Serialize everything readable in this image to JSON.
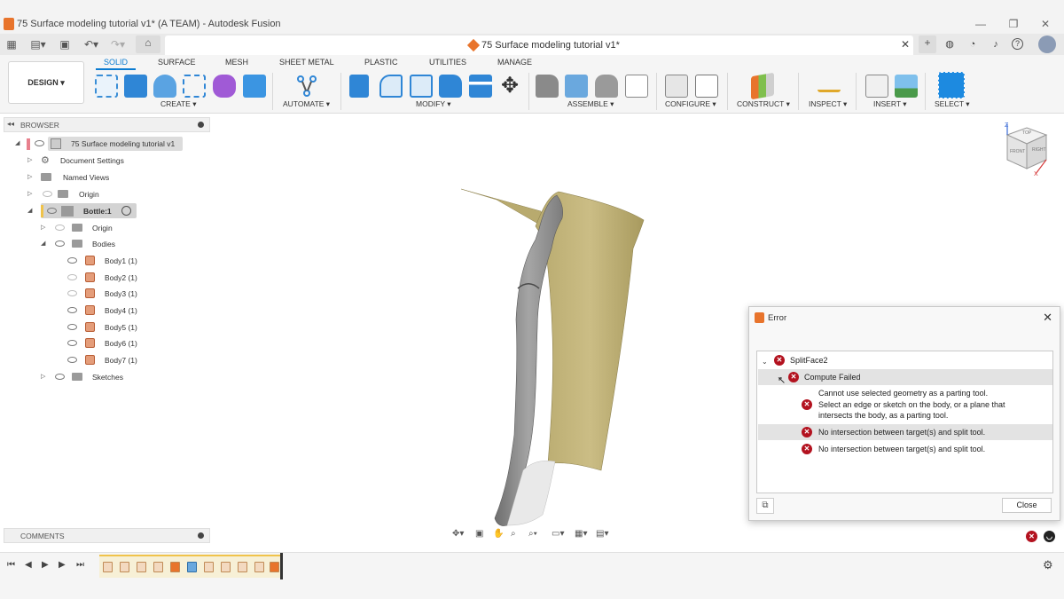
{
  "window": {
    "title": "75 Surface modeling tutorial v1* (A TEAM) - Autodesk Fusion",
    "minimize": "—",
    "maximize": "❐",
    "close": "✕"
  },
  "tabbar": {
    "document_tab": "75 Surface modeling tutorial v1*",
    "document_close": "✕",
    "new_tab": "+"
  },
  "toolbar": {
    "workspace_button": "DESIGN ▾",
    "workspace_tabs": [
      "SOLID",
      "SURFACE",
      "MESH",
      "SHEET METAL",
      "PLASTIC",
      "UTILITIES",
      "MANAGE"
    ],
    "active_tab": "SOLID",
    "groups": [
      {
        "label": "CREATE ▾"
      },
      {
        "label": "AUTOMATE ▾"
      },
      {
        "label": "MODIFY ▾"
      },
      {
        "label": "ASSEMBLE ▾"
      },
      {
        "label": "CONFIGURE ▾"
      },
      {
        "label": "CONSTRUCT ▾"
      },
      {
        "label": "INSPECT ▾"
      },
      {
        "label": "INSERT ▾"
      },
      {
        "label": "SELECT ▾"
      }
    ],
    "accent_color": "#0a7bd1"
  },
  "browser": {
    "title": "BROWSER",
    "root": "75 Surface modeling tutorial v1",
    "items": [
      {
        "label": "Document Settings"
      },
      {
        "label": "Named Views"
      },
      {
        "label": "Origin"
      },
      {
        "label": "Bottle:1"
      },
      {
        "label": "Origin"
      },
      {
        "label": "Bodies"
      },
      {
        "label": "Body1 (1)"
      },
      {
        "label": "Body2 (1)"
      },
      {
        "label": "Body3 (1)"
      },
      {
        "label": "Body4 (1)"
      },
      {
        "label": "Body5 (1)"
      },
      {
        "label": "Body6 (1)"
      },
      {
        "label": "Body7 (1)"
      },
      {
        "label": "Sketches"
      }
    ]
  },
  "comments": {
    "title": "COMMENTS"
  },
  "viewcube": {
    "top": "TOP",
    "front": "FRONT",
    "right": "RIGHT",
    "axis_z": "Z",
    "axis_x": "X"
  },
  "error_dialog": {
    "title": "Error",
    "feature": "SplitFace2",
    "status": "Compute Failed",
    "messages": [
      "Cannot use selected geometry as a parting tool.",
      "Select an edge or sketch on the body, or a plane that",
      "intersects the body, as a parting tool.",
      "No intersection between target(s) and split tool.",
      "No intersection between target(s) and split tool."
    ],
    "close_label": "Close",
    "error_color": "#b3121f"
  }
}
